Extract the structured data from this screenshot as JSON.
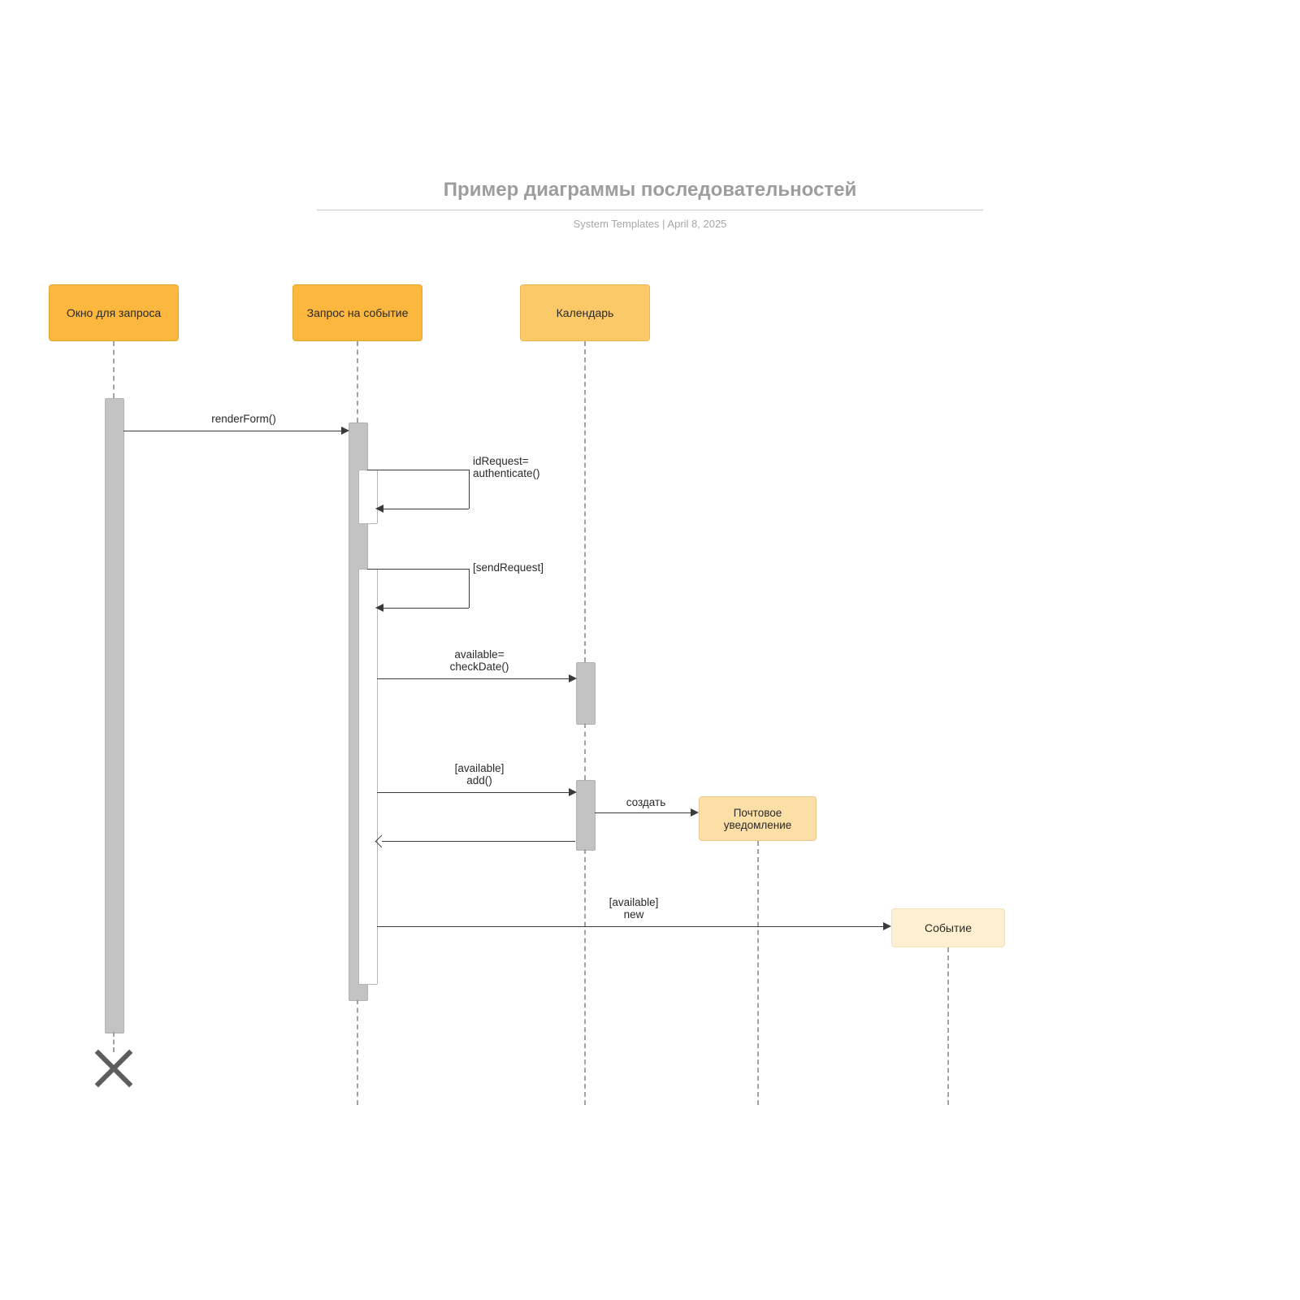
{
  "header": {
    "title": "Пример диаграммы последовательностей",
    "author": "System Templates",
    "date": "April 8, 2025",
    "separator": " | "
  },
  "participants": {
    "p1": "Окно для запроса",
    "p2": "Запрос на событие",
    "p3": "Календарь",
    "p4": "Почтовое\nуведомление",
    "p5": "Событие"
  },
  "messages": {
    "m1": "renderForm()",
    "m2": "idRequest=\nauthenticate()",
    "m3": "[sendRequest]",
    "m4": "available=\ncheckDate()",
    "m5": "[available]\nadd()",
    "m6": "создать",
    "m7": "[available]\nnew"
  }
}
